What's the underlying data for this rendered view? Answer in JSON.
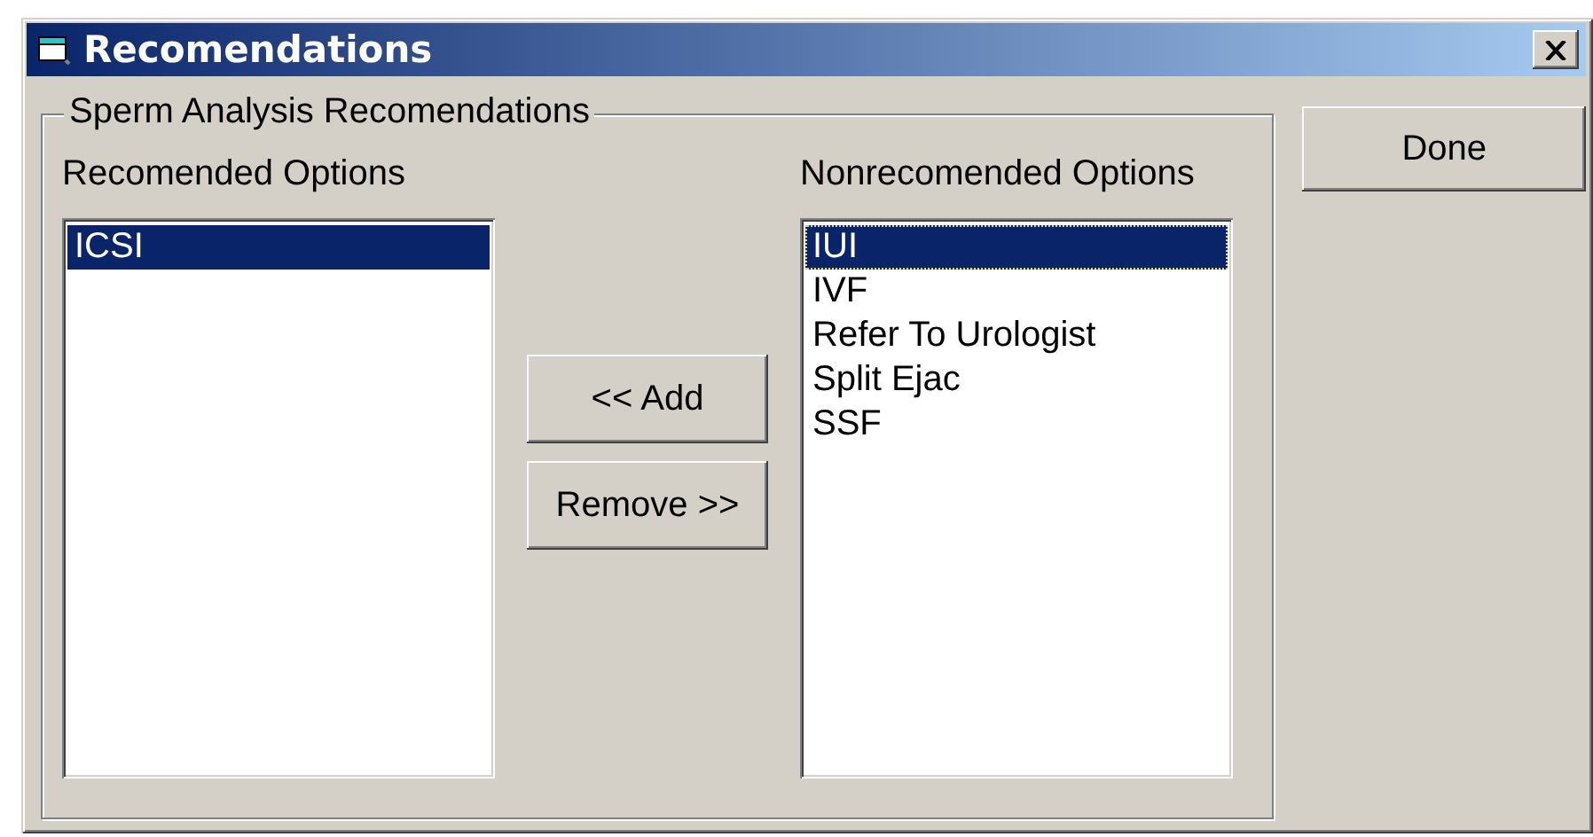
{
  "window": {
    "title": "Recomendations"
  },
  "group": {
    "title": "Sperm Analysis Recomendations"
  },
  "recommended": {
    "label": "Recomended Options",
    "items": [
      {
        "text": "ICSI",
        "selected": true,
        "focused": false
      }
    ]
  },
  "buttons": [
    {
      "label": "<< Add"
    },
    {
      "label": "Remove >>"
    }
  ],
  "nonrecommended": {
    "label": "Nonrecomended Options",
    "items": [
      {
        "text": "IUI",
        "selected": true,
        "focused": true
      },
      {
        "text": "IVF",
        "selected": false,
        "focused": false
      },
      {
        "text": "Refer To Urologist",
        "selected": false,
        "focused": false
      },
      {
        "text": "Split Ejac",
        "selected": false,
        "focused": false
      },
      {
        "text": "SSF",
        "selected": false,
        "focused": false
      }
    ]
  },
  "done_button": {
    "label": "Done"
  }
}
